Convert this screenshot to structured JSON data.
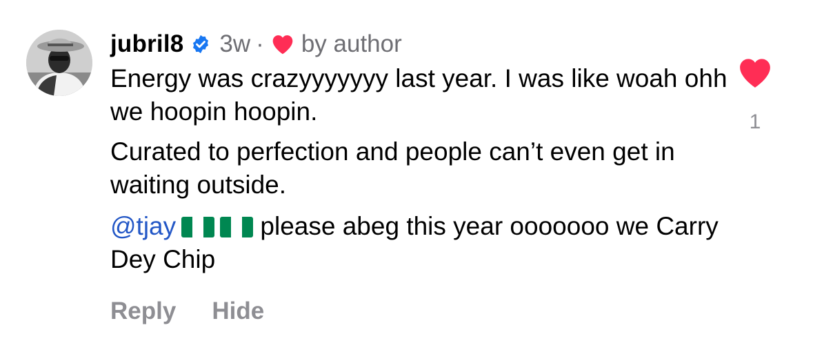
{
  "comment": {
    "username": "jubril8",
    "time": "3w",
    "separator": "·",
    "author_badge": "by author",
    "paragraphs": [
      "Energy was crazyyyyyyy last year.  I was like woah ohh we hoopin hoopin.",
      "Curated to perfection and people can’t even get in waiting outside."
    ],
    "last_paragraph": {
      "mention": "@tjay",
      "flags": [
        "nigeria-flag",
        "nigeria-flag"
      ],
      "text": "please abeg this year ooooooo we Carry Dey Chip"
    },
    "like_count": "1"
  },
  "actions": {
    "reply_label": "Reply",
    "hide_label": "Hide"
  },
  "icons": {
    "verified": "verified-badge-icon",
    "author_heart": "heart-icon",
    "like": "heart-icon"
  },
  "colors": {
    "verified_blue": "#1877F2",
    "heart_red": "#FF2D55",
    "mention_blue": "#2357C6",
    "secondary_gray": "#8E8E93",
    "flag_green": "#008751"
  }
}
